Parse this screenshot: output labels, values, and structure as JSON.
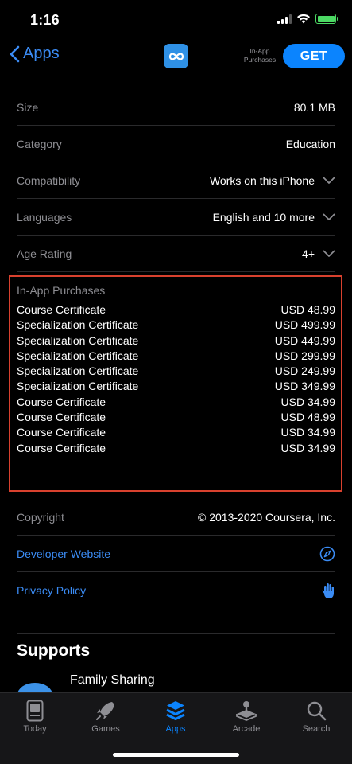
{
  "status": {
    "time": "1:16"
  },
  "nav": {
    "back_label": "Apps",
    "in_app_label": "In-App Purchases",
    "get_label": "GET"
  },
  "info": [
    {
      "label": "Size",
      "value": "80.1 MB"
    },
    {
      "label": "Category",
      "value": "Education"
    },
    {
      "label": "Compatibility",
      "value": "Works on this iPhone"
    },
    {
      "label": "Languages",
      "value": "English and 10 more"
    },
    {
      "label": "Age Rating",
      "value": "4+"
    }
  ],
  "iap": {
    "title": "In-App Purchases",
    "items": [
      {
        "name": "Course Certificate",
        "price": "USD 48.99"
      },
      {
        "name": "Specialization Certificate",
        "price": "USD 499.99"
      },
      {
        "name": "Specialization Certificate",
        "price": "USD 449.99"
      },
      {
        "name": "Specialization Certificate",
        "price": "USD 299.99"
      },
      {
        "name": "Specialization Certificate",
        "price": "USD 249.99"
      },
      {
        "name": "Specialization Certificate",
        "price": "USD 349.99"
      },
      {
        "name": "Course Certificate",
        "price": "USD 34.99"
      },
      {
        "name": "Course Certificate",
        "price": "USD 48.99"
      },
      {
        "name": "Course Certificate",
        "price": "USD 34.99"
      },
      {
        "name": "Course Certificate",
        "price": "USD 34.99"
      }
    ]
  },
  "copyright": {
    "label": "Copyright",
    "value": "© 2013-2020 Coursera, Inc."
  },
  "links": {
    "developer_website": "Developer Website",
    "privacy_policy": "Privacy Policy"
  },
  "supports": {
    "title": "Supports",
    "family_sharing": "Family Sharing"
  },
  "tabs": [
    {
      "label": "Today",
      "icon": "today-icon"
    },
    {
      "label": "Games",
      "icon": "rocket-icon"
    },
    {
      "label": "Apps",
      "icon": "layers-icon",
      "active": true
    },
    {
      "label": "Arcade",
      "icon": "joystick-icon"
    },
    {
      "label": "Search",
      "icon": "search-icon"
    }
  ],
  "colors": {
    "accent": "#0b84fe",
    "link": "#3b8cf5",
    "highlight_border": "#d9412e",
    "battery": "#4cd964"
  }
}
